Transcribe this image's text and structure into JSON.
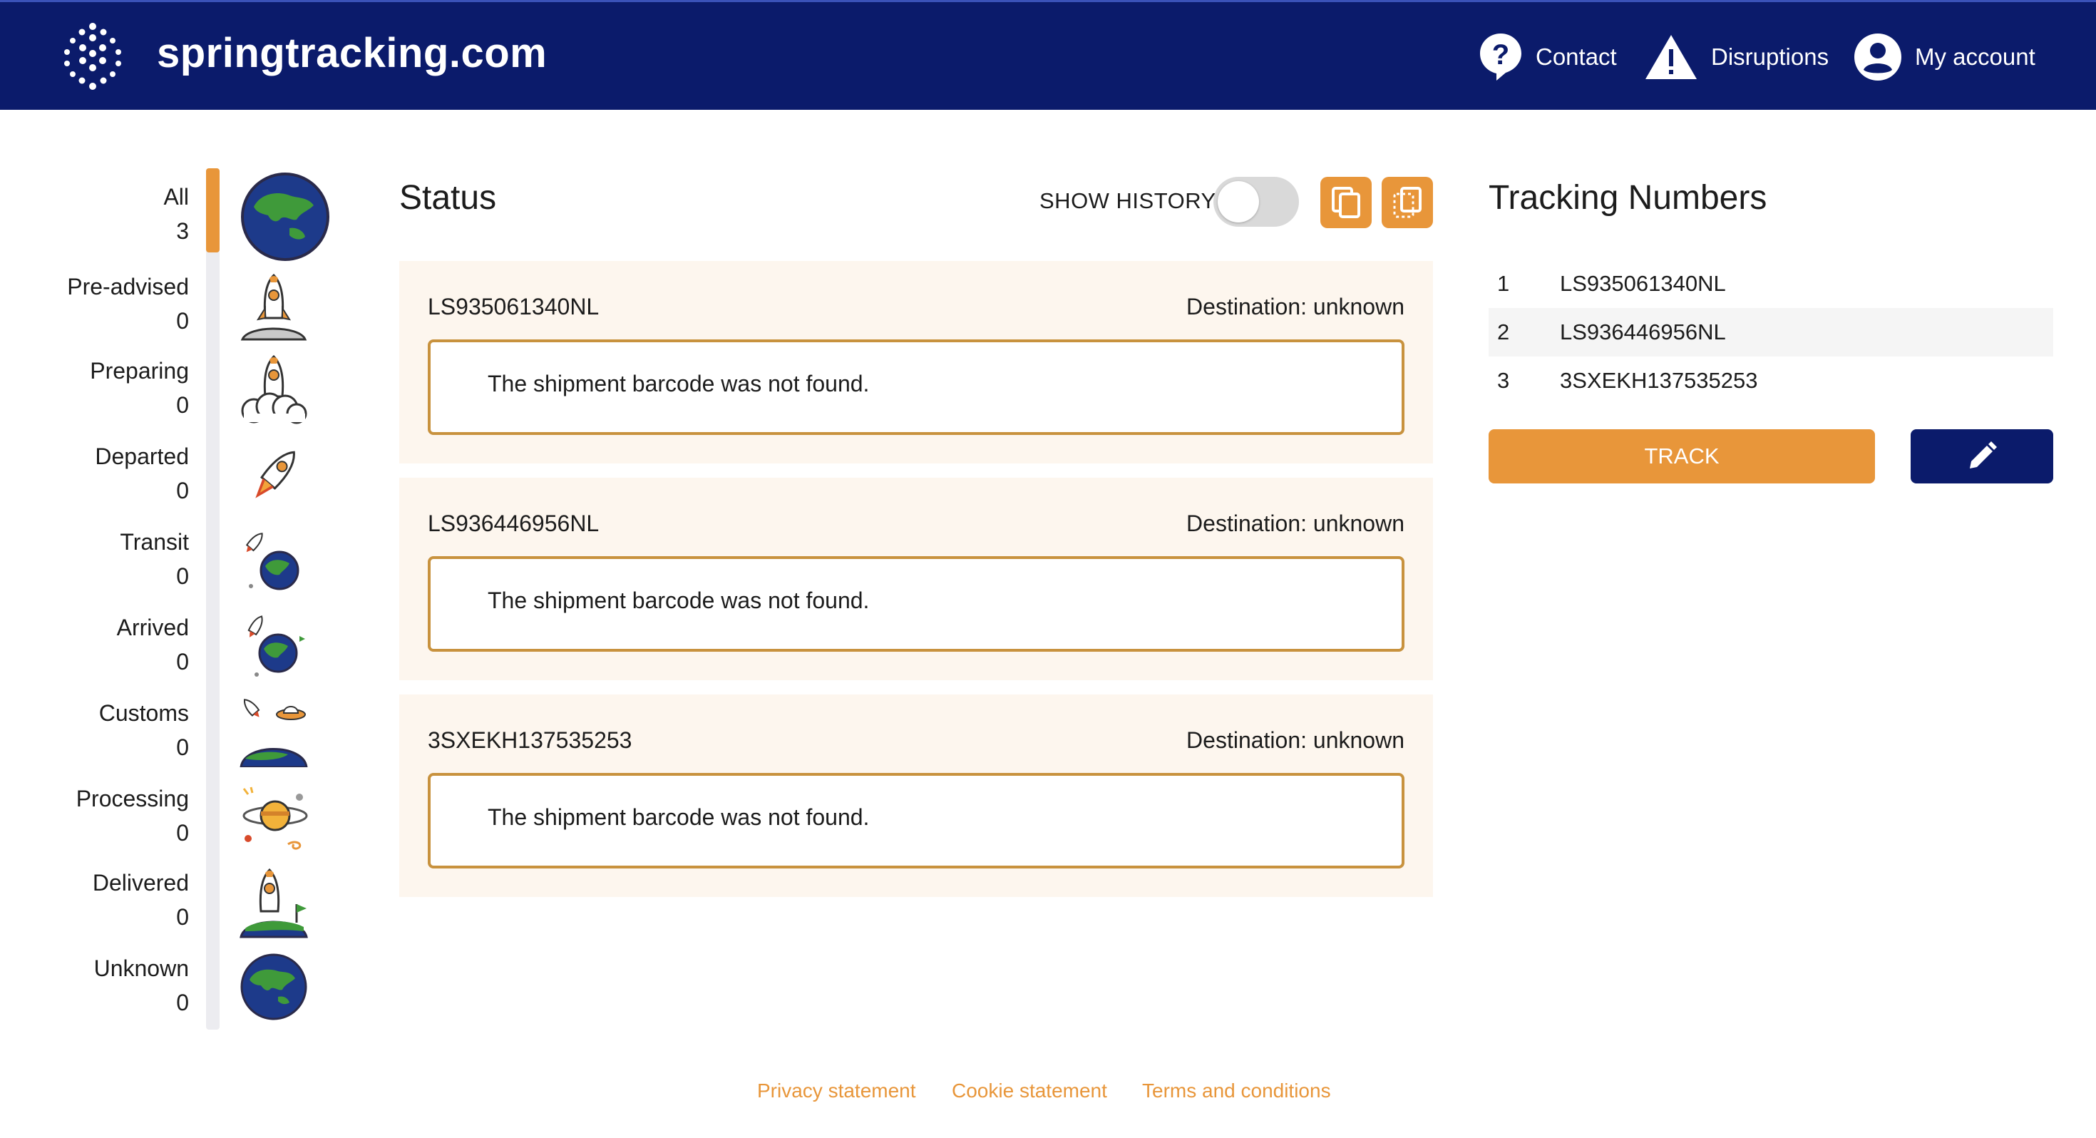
{
  "header": {
    "brand": "springtracking.com",
    "nav": {
      "contact": "Contact",
      "disruptions": "Disruptions",
      "account": "My account"
    }
  },
  "sidebar": {
    "categories": [
      {
        "label": "All",
        "count": "3",
        "icon": "earth-icon"
      },
      {
        "label": "Pre-advised",
        "count": "0",
        "icon": "rocket-on-moon-icon"
      },
      {
        "label": "Preparing",
        "count": "0",
        "icon": "rocket-launch-cloud-icon"
      },
      {
        "label": "Departed",
        "count": "0",
        "icon": "rocket-flying-icon"
      },
      {
        "label": "Transit",
        "count": "0",
        "icon": "rocket-to-earth-icon"
      },
      {
        "label": "Arrived",
        "count": "0",
        "icon": "rocket-arrived-earth-icon"
      },
      {
        "label": "Customs",
        "count": "0",
        "icon": "ufo-customs-icon"
      },
      {
        "label": "Processing",
        "count": "0",
        "icon": "planet-processing-icon"
      },
      {
        "label": "Delivered",
        "count": "0",
        "icon": "rocket-delivered-flag-icon"
      },
      {
        "label": "Unknown",
        "count": "0",
        "icon": "earth-icon"
      }
    ]
  },
  "status": {
    "title": "Status",
    "show_history_label": "SHOW HISTORY",
    "show_history_enabled": false,
    "shipments": [
      {
        "code": "LS935061340NL",
        "destination": "Destination: unknown",
        "message": "The shipment barcode was not found."
      },
      {
        "code": "LS936446956NL",
        "destination": "Destination: unknown",
        "message": "The shipment barcode was not found."
      },
      {
        "code": "3SXEKH137535253",
        "destination": "Destination: unknown",
        "message": "The shipment barcode was not found."
      }
    ]
  },
  "tracking": {
    "title": "Tracking Numbers",
    "numbers": [
      {
        "index": "1",
        "number": "LS935061340NL"
      },
      {
        "index": "2",
        "number": "LS936446956NL"
      },
      {
        "index": "3",
        "number": "3SXEKH137535253"
      }
    ],
    "track_label": "TRACK"
  },
  "footer": {
    "privacy": "Privacy statement",
    "cookie": "Cookie statement",
    "terms": "Terms and conditions"
  },
  "colors": {
    "header_bg": "#0b1b6b",
    "accent": "#e8963a",
    "card_bg": "#fdf6ee",
    "message_border": "#c8923e"
  }
}
